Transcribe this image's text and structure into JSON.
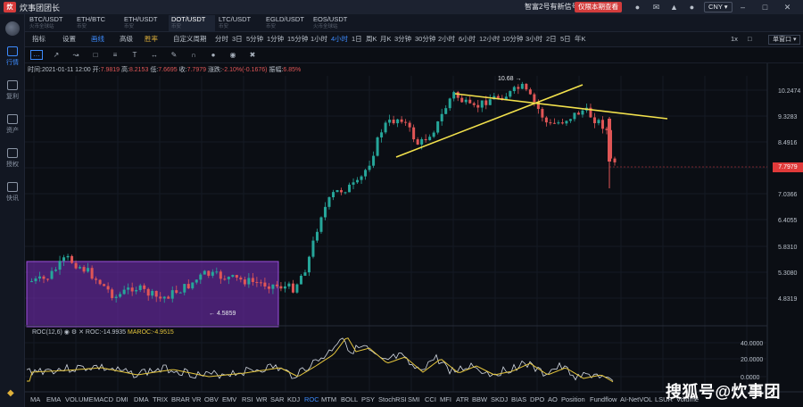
{
  "titlebar": {
    "app_name": "炊事团团长",
    "notice": "智富2号有新信号",
    "notice_action": "仅限本期查看",
    "currency": "CNY ▾"
  },
  "tabs": [
    {
      "pair": "BTC/USDT",
      "sub": "火币全球站"
    },
    {
      "pair": "ETH/BTC",
      "sub": "币安"
    },
    {
      "pair": "ETH/USDT",
      "sub": "币安"
    },
    {
      "pair": "DOT/USDT",
      "sub": "币安"
    },
    {
      "pair": "LTC/USDT",
      "sub": "币安"
    },
    {
      "pair": "EGLD/USDT",
      "sub": "币安"
    },
    {
      "pair": "EOS/USDT",
      "sub": "火币全球站"
    }
  ],
  "sidebar": {
    "items": [
      {
        "label": "行情"
      },
      {
        "label": "复利"
      },
      {
        "label": "资产"
      },
      {
        "label": "授权"
      },
      {
        "label": "快讯"
      }
    ]
  },
  "toolbar": {
    "items": [
      "指标",
      "设置",
      "画线",
      "高级",
      "胜率"
    ],
    "period_label": "自定义周期",
    "periods": [
      "分时",
      "3日",
      "5分钟",
      "1分钟",
      "15分钟",
      "1小时",
      "4小时",
      "1日",
      "周K",
      "月K",
      "3分钟",
      "30分钟",
      "2小时",
      "6小时",
      "12小时",
      "10分钟",
      "3小时",
      "2日",
      "5日",
      "年K"
    ],
    "active_period": "4小时",
    "scale_label": "1x",
    "layout_label": "单窗口 ▾"
  },
  "ohlc": {
    "time_label": "时间:",
    "time": "2021-01-11 12:00",
    "open_label": "开:",
    "open": "7.9819",
    "high_label": "高:",
    "high": "8.2153",
    "low_label": "低:",
    "low": "7.6695",
    "close_label": "收:",
    "close": "7.7979",
    "change_label": "涨跌:",
    "change": "-2.10%(-0.1676)",
    "amp_label": "振幅:",
    "amp": "6.85%"
  },
  "price_axis": [
    "10.2474",
    "9.3283",
    "8.4916",
    "7.7979",
    "7.0366",
    "6.4055",
    "5.8310",
    "5.3080",
    "4.8319"
  ],
  "current_price": "7.7979",
  "annotations": {
    "high": "10.68",
    "low": "4.5859"
  },
  "roc": {
    "name": "ROC(12,6)",
    "roc": "ROC:-14.9935",
    "maroc": "MAROC:-4.9515",
    "axis": [
      "40.0000",
      "20.0000",
      "0.0000"
    ]
  },
  "indicators": [
    "MA",
    "EMA",
    "VOLUME",
    "MACD",
    "DMI",
    "DMA",
    "TRIX",
    "BRAR",
    "VR",
    "OBV",
    "EMV",
    "RSI",
    "WR",
    "SAR",
    "KDJ",
    "ROC",
    "MTM",
    "BOLL",
    "PSY",
    "StochRSI",
    "SMI",
    "CCI",
    "MFI",
    "ATR",
    "BBW",
    "SKDJ",
    "BIAS",
    "DPO",
    "AO",
    "Position",
    "Fundflow",
    "AI-NetVOL",
    "LSUR",
    "Volume"
  ],
  "active_indicator": "ROC",
  "watermark": "搜狐号@炊事团",
  "colors": {
    "up": "#26a69a",
    "down": "#e05656",
    "accent": "#3d8bfd",
    "box": "#7b2fbe",
    "trendline": "#f2e14c"
  }
}
